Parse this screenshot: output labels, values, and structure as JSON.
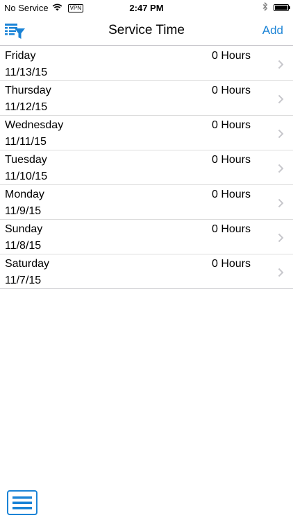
{
  "status_bar": {
    "carrier": "No Service",
    "vpn": "VPN",
    "time": "2:47 PM",
    "icons": [
      "wifi-icon",
      "bluetooth-icon",
      "battery-icon"
    ]
  },
  "nav": {
    "title": "Service Time",
    "add_label": "Add",
    "filter_icon": "filter-list-icon",
    "accent_color": "#1a83d6"
  },
  "entries": [
    {
      "day": "Friday",
      "date": "11/13/15",
      "hours": "0 Hours"
    },
    {
      "day": "Thursday",
      "date": "11/12/15",
      "hours": "0 Hours"
    },
    {
      "day": "Wednesday",
      "date": "11/11/15",
      "hours": "0 Hours"
    },
    {
      "day": "Tuesday",
      "date": "11/10/15",
      "hours": "0 Hours"
    },
    {
      "day": "Monday",
      "date": "11/9/15",
      "hours": "0 Hours"
    },
    {
      "day": "Sunday",
      "date": "11/8/15",
      "hours": "0 Hours"
    },
    {
      "day": "Saturday",
      "date": "11/7/15",
      "hours": "0 Hours"
    }
  ],
  "bottom": {
    "menu_icon": "hamburger-menu-icon"
  }
}
